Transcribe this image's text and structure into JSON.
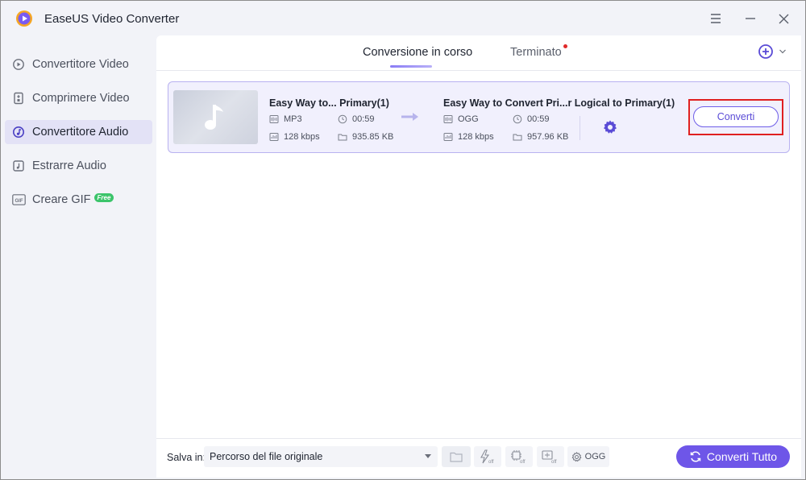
{
  "app": {
    "title": "EaseUS Video Converter"
  },
  "sidebar": {
    "items": [
      {
        "label": "Convertitore Video",
        "icon": "video-convert-icon",
        "active": false
      },
      {
        "label": "Comprimere Video",
        "icon": "compress-icon",
        "active": false
      },
      {
        "label": "Convertitore Audio",
        "icon": "audio-convert-icon",
        "active": true
      },
      {
        "label": "Estrarre Audio",
        "icon": "extract-audio-icon",
        "active": false
      },
      {
        "label": "Creare GIF",
        "icon": "gif-icon",
        "active": false,
        "badge": "Free"
      }
    ]
  },
  "tabs": {
    "converting": "Conversione in corso",
    "finished": "Terminato"
  },
  "file": {
    "source": {
      "name": "Easy Way to... Primary(1)",
      "format": "MP3",
      "duration": "00:59",
      "bitrate": "128 kbps",
      "size": "935.85 KB"
    },
    "target": {
      "name": "Easy Way to Convert Pri...r Logical to Primary(1)",
      "format": "OGG",
      "duration": "00:59",
      "bitrate": "128 kbps",
      "size": "957.96 KB"
    },
    "convert_label": "Converti"
  },
  "bottom": {
    "save_label": "Salva in:",
    "save_path": "Percorso del file originale",
    "format": "OGG",
    "convert_all_label": "Converti Tutto"
  },
  "colors": {
    "accent": "#6e56e8",
    "highlight": "#e02020",
    "active_bg": "#e3e2f6"
  }
}
